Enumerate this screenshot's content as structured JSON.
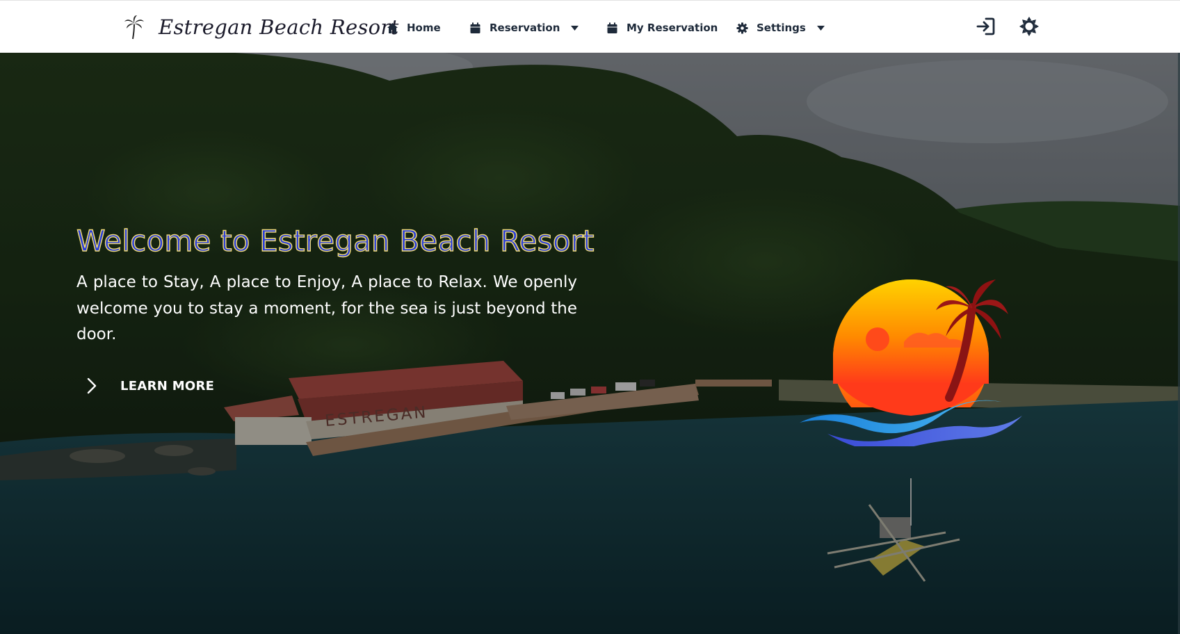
{
  "brand": {
    "name": "Estregan Beach Resort",
    "icon": "palm-tree-icon"
  },
  "nav": {
    "home": {
      "label": "Home",
      "icon": "home-icon"
    },
    "reservation": {
      "label": "Reservation",
      "icon": "calendar-icon",
      "dropdown": true
    },
    "my_reservation": {
      "label": "My Reservation",
      "icon": "calendar-icon"
    },
    "settings": {
      "label": "Settings",
      "icon": "gear-icon",
      "dropdown": true
    }
  },
  "actions": {
    "login_icon": "login-icon",
    "theme_icon": "sun-icon"
  },
  "hero": {
    "title": "Welcome to Estregan Beach Resort",
    "description": "A place to Stay, A place to Enjoy, A place to Relax. We openly welcome you to stay a moment, for the sea is just beyond the door.",
    "cta_label": "LEARN MORE",
    "building_sign": "ESTREGAN"
  },
  "colors": {
    "title_fill": "#2b3fd8",
    "title_outline": "#f3dd7a",
    "navbar_bg": "#ffffff",
    "nav_text": "#1e2a3a"
  }
}
